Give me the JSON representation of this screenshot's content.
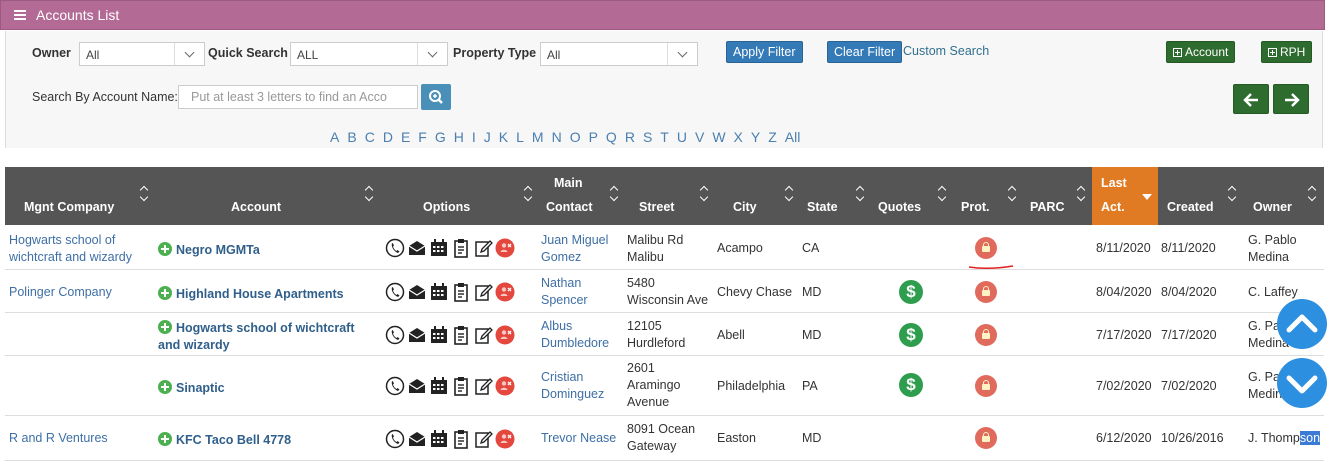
{
  "header": {
    "title": "Accounts List"
  },
  "filters": {
    "owner_label": "Owner",
    "owner_value": "All",
    "quick_search_label": "Quick Search",
    "quick_search_value": "ALL",
    "property_type_label": "Property Type",
    "property_type_value": "All",
    "apply_filter": "Apply Filter",
    "clear_filter": "Clear Filter",
    "custom_search": "Custom Search",
    "add_account": "Account",
    "add_rph": "RPH",
    "search_label": "Search By Account Name:",
    "search_placeholder": "Put at least 3 letters to find an Acco"
  },
  "alphabet": [
    "A",
    "B",
    "C",
    "D",
    "E",
    "F",
    "G",
    "H",
    "I",
    "J",
    "K",
    "L",
    "M",
    "N",
    "O",
    "P",
    "Q",
    "R",
    "S",
    "T",
    "U",
    "V",
    "W",
    "X",
    "Y",
    "Z",
    "All"
  ],
  "columns": {
    "mgnt_company": "Mgnt Company",
    "account": "Account",
    "options": "Options",
    "main_contact_1": "Main",
    "main_contact_2": "Contact",
    "street": "Street",
    "city": "City",
    "state": "State",
    "quotes": "Quotes",
    "prot": "Prot.",
    "parc": "PARC",
    "last_act_1": "Last",
    "last_act_2": "Act.",
    "created": "Created",
    "owner": "Owner"
  },
  "rows": [
    {
      "mgnt": [
        "Hogwarts school of",
        "wichtcraft and wizardy"
      ],
      "account": "Negro MGMTa",
      "contact": [
        "Juan Miguel",
        "Gomez"
      ],
      "street": [
        "Malibu Rd",
        "Malibu"
      ],
      "city": "Acampo",
      "state": "CA",
      "quote": "",
      "last": "8/11/2020",
      "created": "8/11/2020",
      "owner": [
        "G. Pablo",
        "Medina"
      ]
    },
    {
      "mgnt": [
        "Polinger Company"
      ],
      "account": "Highland House Apartments",
      "contact": [
        "Nathan",
        "Spencer"
      ],
      "street": [
        "5480",
        "Wisconsin Ave"
      ],
      "city": "Chevy Chase",
      "state": "MD",
      "quote": "$",
      "last": "8/04/2020",
      "created": "8/04/2020",
      "owner": [
        "C. Laffey"
      ]
    },
    {
      "mgnt": [],
      "account": "Hogwarts school of wichtcraft",
      "account2": "and wizardy",
      "contact": [
        "Albus",
        "Dumbledore"
      ],
      "street": [
        "12105",
        "Hurdleford"
      ],
      "city": "Abell",
      "state": "MD",
      "quote": "$",
      "last": "7/17/2020",
      "created": "7/17/2020",
      "owner": [
        "G. Pab",
        "Medina"
      ]
    },
    {
      "mgnt": [],
      "account": "Sinaptic",
      "contact": [
        "Cristian",
        "Dominguez"
      ],
      "street": [
        "2601",
        "Aramingo",
        "Avenue"
      ],
      "city": "Philadelphia",
      "state": "PA",
      "quote": "$",
      "last": "7/02/2020",
      "created": "7/02/2020",
      "owner": [
        "G. Pab",
        "Medin"
      ]
    },
    {
      "mgnt": [
        "R and R Ventures"
      ],
      "account": "KFC Taco Bell 4778",
      "contact": [
        "Trevor Nease"
      ],
      "street": [
        "8091 Ocean",
        "Gateway"
      ],
      "city": "Easton",
      "state": "MD",
      "quote": "",
      "last": "6/12/2020",
      "created": "10/26/2016",
      "owner_a": "J. Thomp",
      "owner_b": "son"
    }
  ],
  "colors": {
    "title_bar": "#b36b96",
    "header_bg": "#555555",
    "active_sort": "#e07b24",
    "green_btn": "#2e6b2e",
    "blue_btn": "#337ab7"
  }
}
